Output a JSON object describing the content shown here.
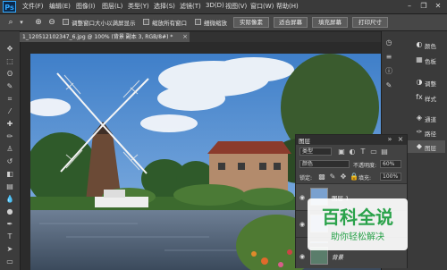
{
  "app": {
    "logo": "Ps"
  },
  "menu": [
    "文件(F)",
    "编辑(E)",
    "图像(I)",
    "图层(L)",
    "类型(Y)",
    "选择(S)",
    "滤镜(T)",
    "3D(D)",
    "视图(V)",
    "窗口(W)",
    "帮助(H)"
  ],
  "window_controls": {
    "minimize": "–",
    "restore": "❐",
    "close": "✕"
  },
  "options": {
    "resize_windows": "调整窗口大小以满屏显示",
    "zoom_all": "缩放所有窗口",
    "scrubby_zoom": "细微缩放",
    "actual_pixels": "实际像素",
    "fit_screen": "适合屏幕",
    "fill_screen": "填充屏幕",
    "print_size": "打印尺寸"
  },
  "document_tab": {
    "title": "1_120512102347_6.jpg @ 100% (背景 副本 3, RGB/8#) *",
    "close": "×"
  },
  "panels": {
    "color": "颜色",
    "swatches": "色板",
    "adjustments": "调整",
    "styles": "样式",
    "channels": "通道",
    "paths": "路径",
    "layers": "图层"
  },
  "layers_panel": {
    "title": "图层",
    "kind_filter": "类型",
    "blend_mode": "颜色",
    "opacity_label": "不透明度:",
    "opacity_value": "60%",
    "lock_label": "锁定:",
    "fill_label": "填充:",
    "fill_value": "100%",
    "layers": [
      {
        "name": "图层 1"
      },
      {
        "name": ""
      },
      {
        "name": ""
      },
      {
        "name": "背景"
      }
    ]
  },
  "watermark": {
    "title": "百科全说",
    "subtitle": "助你轻松解决"
  },
  "colors": {
    "accent": "#31a8ff",
    "sky": "#5d92d0",
    "watermark_bg": "#ffffff",
    "watermark_text": "#2aa24a"
  }
}
